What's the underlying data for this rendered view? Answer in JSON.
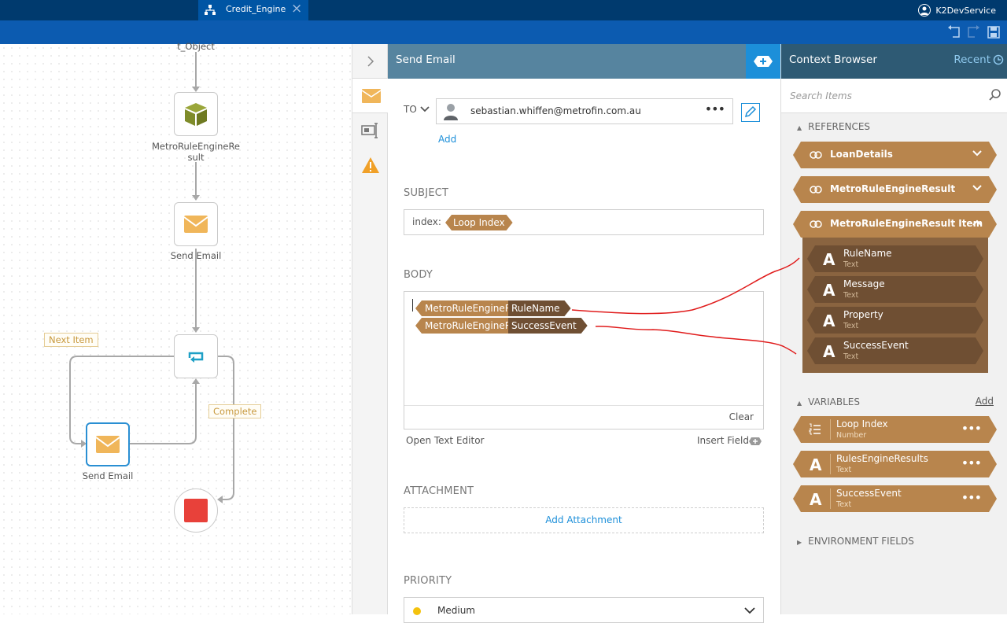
{
  "top_bar": {
    "tab_title": "Credit_Engine",
    "user_name": "K2DevService"
  },
  "canvas": {
    "partial_label": "t_Object",
    "nodes": [
      {
        "label": "MetroRuleEngineRe",
        "label2": "sult",
        "icon": "cube-icon"
      },
      {
        "label": "Send Email",
        "icon": "envelope-icon"
      },
      {
        "label": "",
        "icon": "loop-icon"
      },
      {
        "label": "Send Email",
        "icon": "envelope-icon"
      },
      {
        "label": "",
        "icon": "stop-icon"
      }
    ],
    "next_item_label": "Next Item",
    "complete_label": "Complete"
  },
  "editor": {
    "title": "Send Email",
    "to_label": "TO",
    "to_value": "sebastian.whiffen@metrofin.com.au",
    "add_label": "Add",
    "subject_label": "SUBJECT",
    "subject_prefix": "index:",
    "subject_chip": "Loop Index",
    "body_label": "BODY",
    "body_chips": [
      {
        "source": "MetroRuleEngineResult Item",
        "field": "RuleName"
      },
      {
        "source": "MetroRuleEngineResult Item",
        "field": "SuccessEvent"
      }
    ],
    "clear_label": "Clear",
    "open_text_editor": "Open Text Editor",
    "insert_field": "Insert Field",
    "attachment_label": "ATTACHMENT",
    "add_attachment": "Add Attachment",
    "priority_label": "PRIORITY",
    "priority_value": "Medium"
  },
  "context_browser": {
    "title": "Context Browser",
    "recent_label": "Recent",
    "search_placeholder": "Search Items",
    "references_label": "REFERENCES",
    "references": [
      {
        "label": "LoanDetails"
      },
      {
        "label": "MetroRuleEngineResult"
      },
      {
        "label": "MetroRuleEngineResult Item"
      }
    ],
    "item_fields": [
      {
        "name": "RuleName",
        "type": "Text"
      },
      {
        "name": "Message",
        "type": "Text"
      },
      {
        "name": "Property",
        "type": "Text"
      },
      {
        "name": "SuccessEvent",
        "type": "Text"
      }
    ],
    "variables_label": "VARIABLES",
    "variables_add": "Add",
    "variables": [
      {
        "name": "Loop Index",
        "type": "Number",
        "icon": "list-number-icon"
      },
      {
        "name": "RulesEngineResults",
        "type": "Text",
        "icon": "A"
      },
      {
        "name": "SuccessEvent",
        "type": "Text",
        "icon": "A"
      }
    ],
    "environment_label": "ENVIRONMENT FIELDS"
  },
  "colors": {
    "top_bar": "#003a6e",
    "toolbar": "#0c5bb0",
    "editor_header": "#56849f",
    "context_header": "#2e5a74",
    "chip_light": "#b8854d",
    "chip_dark": "#6f4f33",
    "accent_blue": "#1c8fd9",
    "annotation_red": "#e01b1b"
  }
}
